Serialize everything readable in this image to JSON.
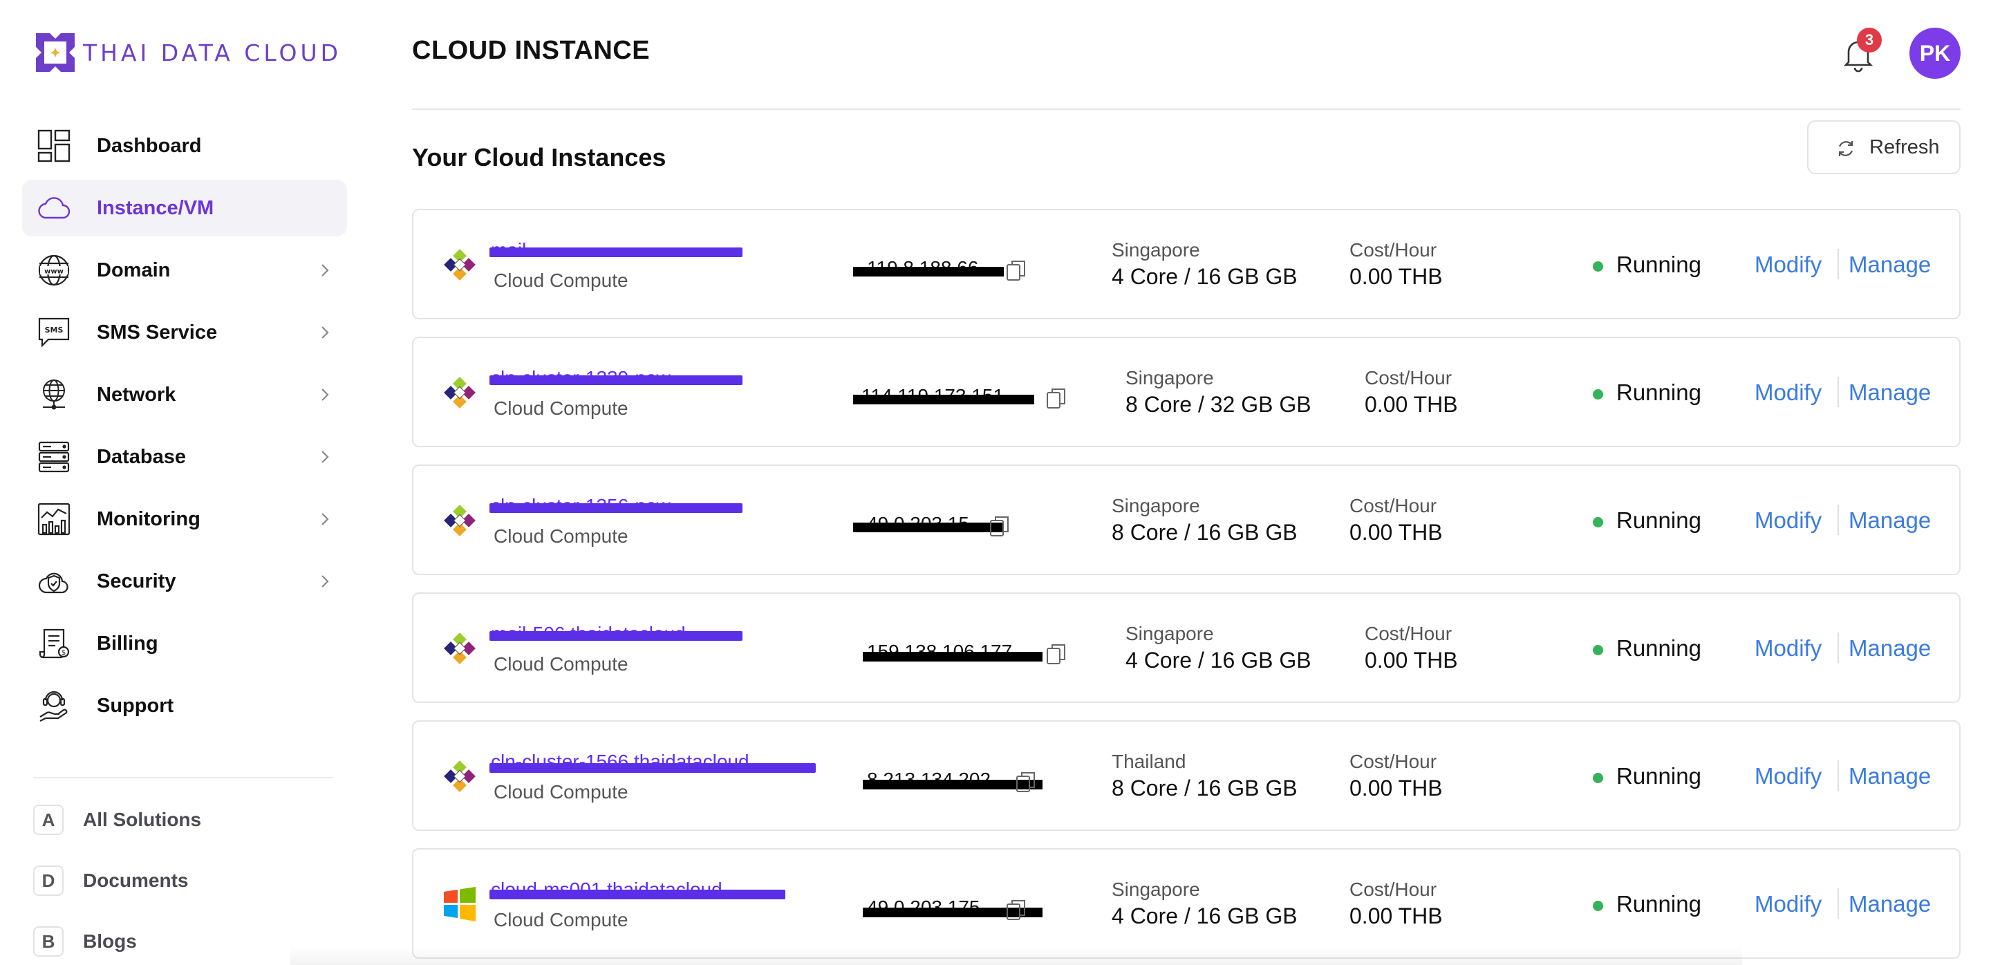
{
  "brand": {
    "name": "THAI DATA CLOUD",
    "color": "#6d3fc9"
  },
  "sidebar": {
    "items": [
      {
        "label": "Dashboard",
        "icon": "dashboard-icon",
        "has_submenu": false,
        "active": false
      },
      {
        "label": "Instance/VM",
        "icon": "cloud-icon",
        "has_submenu": false,
        "active": true
      },
      {
        "label": "Domain",
        "icon": "www-globe-icon",
        "has_submenu": true,
        "active": false
      },
      {
        "label": "SMS Service",
        "icon": "sms-icon",
        "has_submenu": true,
        "active": false
      },
      {
        "label": "Network",
        "icon": "network-globe-icon",
        "has_submenu": true,
        "active": false
      },
      {
        "label": "Database",
        "icon": "database-icon",
        "has_submenu": true,
        "active": false
      },
      {
        "label": "Monitoring",
        "icon": "monitoring-chart-icon",
        "has_submenu": true,
        "active": false
      },
      {
        "label": "Security",
        "icon": "security-shield-icon",
        "has_submenu": true,
        "active": false
      },
      {
        "label": "Billing",
        "icon": "billing-receipt-icon",
        "has_submenu": false,
        "active": false
      },
      {
        "label": "Support",
        "icon": "support-agent-icon",
        "has_submenu": false,
        "active": false
      }
    ],
    "solutions": [
      {
        "letter": "A",
        "label": "All Solutions"
      },
      {
        "letter": "D",
        "label": "Documents"
      },
      {
        "letter": "B",
        "label": "Blogs"
      }
    ]
  },
  "header": {
    "title": "CLOUD INSTANCE",
    "notification_count": "3",
    "avatar_initials": "PK"
  },
  "main": {
    "section_title": "Your Cloud Instances",
    "refresh_label": "Refresh",
    "instances": [
      {
        "os": "centos",
        "name": "mail",
        "type": "Cloud Compute",
        "ip": "119.8.188.66",
        "region": "Singapore",
        "spec": "4 Core / 16 GB GB",
        "cost_label": "Cost/Hour",
        "cost": "0.00 THB",
        "status": "Running",
        "modify": "Modify",
        "manage": "Manage"
      },
      {
        "os": "centos",
        "name": "cln-cluster-1239-new",
        "type": "Cloud Compute",
        "ip": "114.119.173.151",
        "region": "Singapore",
        "spec": "8 Core / 32 GB GB",
        "cost_label": "Cost/Hour",
        "cost": "0.00 THB",
        "status": "Running",
        "modify": "Modify",
        "manage": "Manage"
      },
      {
        "os": "centos",
        "name": "cln-cluster-1356-new",
        "type": "Cloud Compute",
        "ip": "49.0.203.15",
        "region": "Singapore",
        "spec": "8 Core / 16 GB GB",
        "cost_label": "Cost/Hour",
        "cost": "0.00 THB",
        "status": "Running",
        "modify": "Modify",
        "manage": "Manage"
      },
      {
        "os": "centos",
        "name": "mail-506.thaidatacloud",
        "type": "Cloud Compute",
        "ip": "159.138.106.177",
        "region": "Singapore",
        "spec": "4 Core / 16 GB GB",
        "cost_label": "Cost/Hour",
        "cost": "0.00 THB",
        "status": "Running",
        "modify": "Modify",
        "manage": "Manage"
      },
      {
        "os": "centos",
        "name": "cln-cluster-1566.thaidatacloud",
        "type": "Cloud Compute",
        "ip": "8.213.134.202",
        "region": "Thailand",
        "spec": "8 Core / 16 GB GB",
        "cost_label": "Cost/Hour",
        "cost": "0.00 THB",
        "status": "Running",
        "modify": "Modify",
        "manage": "Manage"
      },
      {
        "os": "windows",
        "name": "cloud-ms001.thaidatacloud",
        "type": "Cloud Compute",
        "ip": "49.0.203.175",
        "region": "Singapore",
        "spec": "4 Core / 16 GB GB",
        "cost_label": "Cost/Hour",
        "cost": "0.00 THB",
        "status": "Running",
        "modify": "Modify",
        "manage": "Manage"
      }
    ]
  },
  "colors": {
    "accent": "#6d35d8",
    "link": "#3b7be0",
    "running": "#35b35a",
    "notification": "#e03a46",
    "avatar": "#7c3ce8"
  }
}
